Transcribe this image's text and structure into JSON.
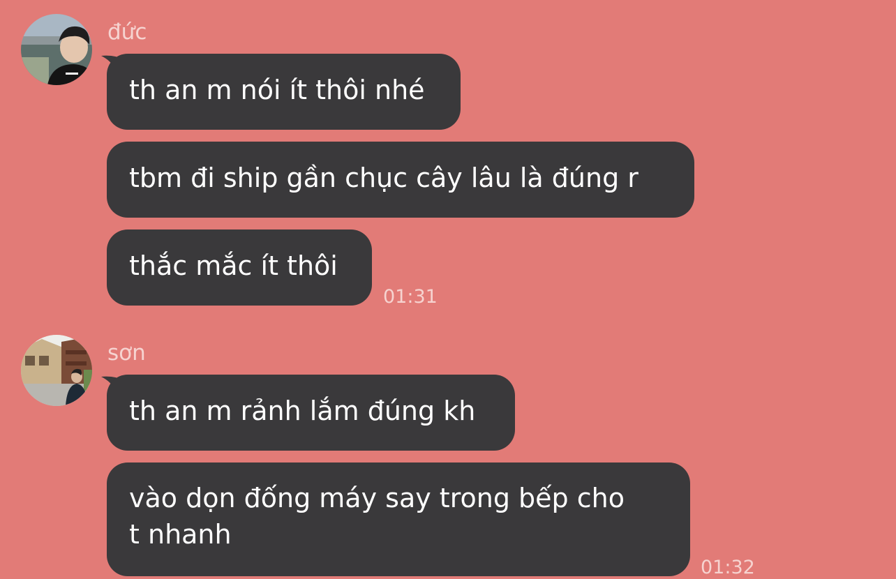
{
  "theme": {
    "background": "#E27B77",
    "bubble": "#3A393B",
    "bubble_text": "#FFFFFF",
    "meta_text": "#F6D3D0"
  },
  "groups": [
    {
      "sender": "đức",
      "messages": [
        "th an m nói ít thôi nhé",
        "tbm đi ship gần chục cây lâu là đúng r",
        "thắc mắc ít thôi"
      ],
      "time": "01:31"
    },
    {
      "sender": "sơn",
      "messages": [
        "th an m rảnh lắm đúng kh"
      ],
      "multiline_message": [
        "vào dọn đống máy say trong bếp cho",
        "t nhanh"
      ],
      "time": "01:32"
    }
  ]
}
